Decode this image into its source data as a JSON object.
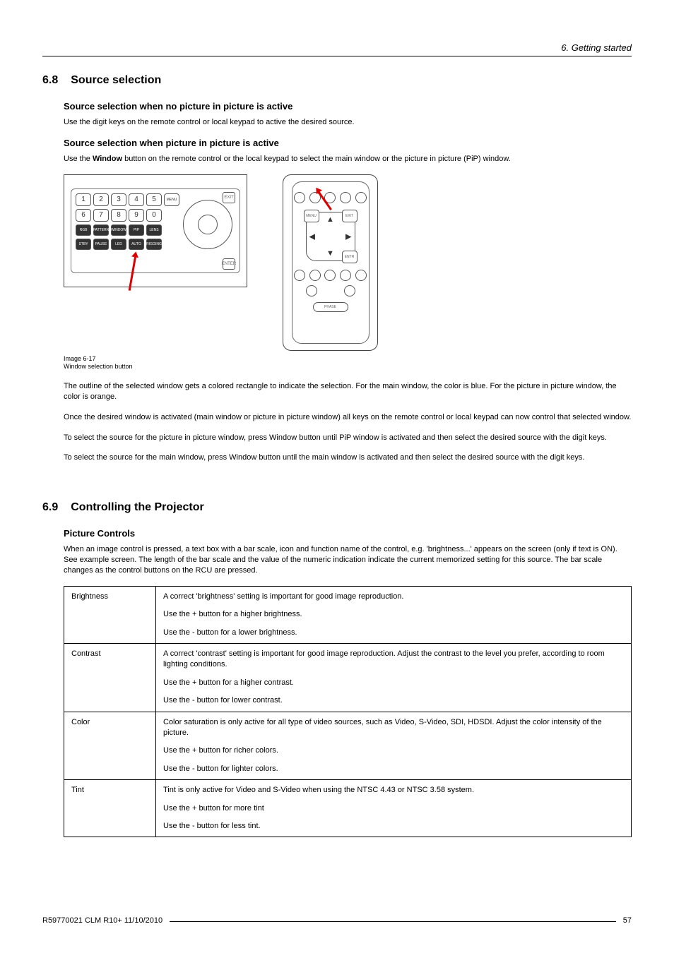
{
  "header": {
    "chapter": "6.  Getting started"
  },
  "s68": {
    "num": "6.8",
    "title": "Source selection",
    "sub1_title": "Source selection when no picture in picture is active",
    "sub1_text": "Use the digit keys on the remote control or local keypad to active the desired source.",
    "sub2_title": "Source selection when picture in picture is active",
    "sub2_text_a": "Use the ",
    "sub2_text_bold": "Window",
    "sub2_text_b": " button on the remote control or the local keypad to select the main window or the picture in picture (PiP) window.",
    "image_caption_a": "Image 6-17",
    "image_caption_b": "Window selection button",
    "p1": "The outline of the selected window gets a colored rectangle to indicate the selection. For the main window, the color is blue. For the picture in picture window, the color is orange.",
    "p2": "Once the desired window is activated (main window or picture in picture window) all keys on the remote control or local keypad can now control that selected window.",
    "p3": "To select the source for the picture in picture window, press Window button until PiP window is activated and then select the desired source with the digit keys.",
    "p4": "To select the source for the main window, press Window button until the main window is activated and then select the desired source with the digit keys."
  },
  "s69": {
    "num": "6.9",
    "title": "Controlling the Projector",
    "sub_title": "Picture Controls",
    "intro": "When an image control is pressed, a text box with a bar scale, icon and function name of the control, e.g. 'brightness...' appears on the screen (only if text is ON). See example screen. The length of the bar scale and the value of the numeric indication indicate the current memorized setting for this source. The bar scale changes as the control buttons on the RCU are pressed.",
    "rows": [
      {
        "label": "Brightness",
        "p1": "A correct 'brightness' setting is important for good image reproduction.",
        "p2": "Use the + button for a higher brightness.",
        "p3": "Use the - button for a lower brightness."
      },
      {
        "label": "Contrast",
        "p1": "A correct 'contrast' setting is important for good image reproduction. Adjust the contrast to the level you prefer, according to room lighting conditions.",
        "p2": "Use the + button for a higher contrast.",
        "p3": "Use the - button for lower contrast."
      },
      {
        "label": "Color",
        "p1": "Color saturation is only active for all type of video sources, such as Video, S-Video, SDI, HDSDI. Adjust the color intensity of the picture.",
        "p2": "Use the + button for richer colors.",
        "p3": "Use the - button for lighter colors."
      },
      {
        "label": "Tint",
        "p1": "Tint is only active for Video and S-Video when using the NTSC 4.43 or NTSC 3.58 system.",
        "p2": "Use the + button for more tint",
        "p3": "Use the - button for less tint."
      }
    ]
  },
  "remote1": {
    "digits_row1": [
      "1",
      "2",
      "3",
      "4",
      "5"
    ],
    "digits_row2": [
      "6",
      "7",
      "8",
      "9",
      "0"
    ],
    "func_row1": [
      "RGB",
      "PATTERN",
      "WINDOW",
      "PIP",
      "LENS"
    ],
    "func_row2": [
      "STBY",
      "PAUSE",
      "LED",
      "AUTO",
      "RIGGING"
    ],
    "menu": "MENU",
    "exit": "EXIT",
    "enter": "ENTER"
  },
  "remote2": {
    "menu": "MENU",
    "exit": "EXIT",
    "entr": "ENTR",
    "phase": "PHASE"
  },
  "footer": {
    "doc": "R59770021  CLM R10+  11/10/2010",
    "page": "57"
  }
}
